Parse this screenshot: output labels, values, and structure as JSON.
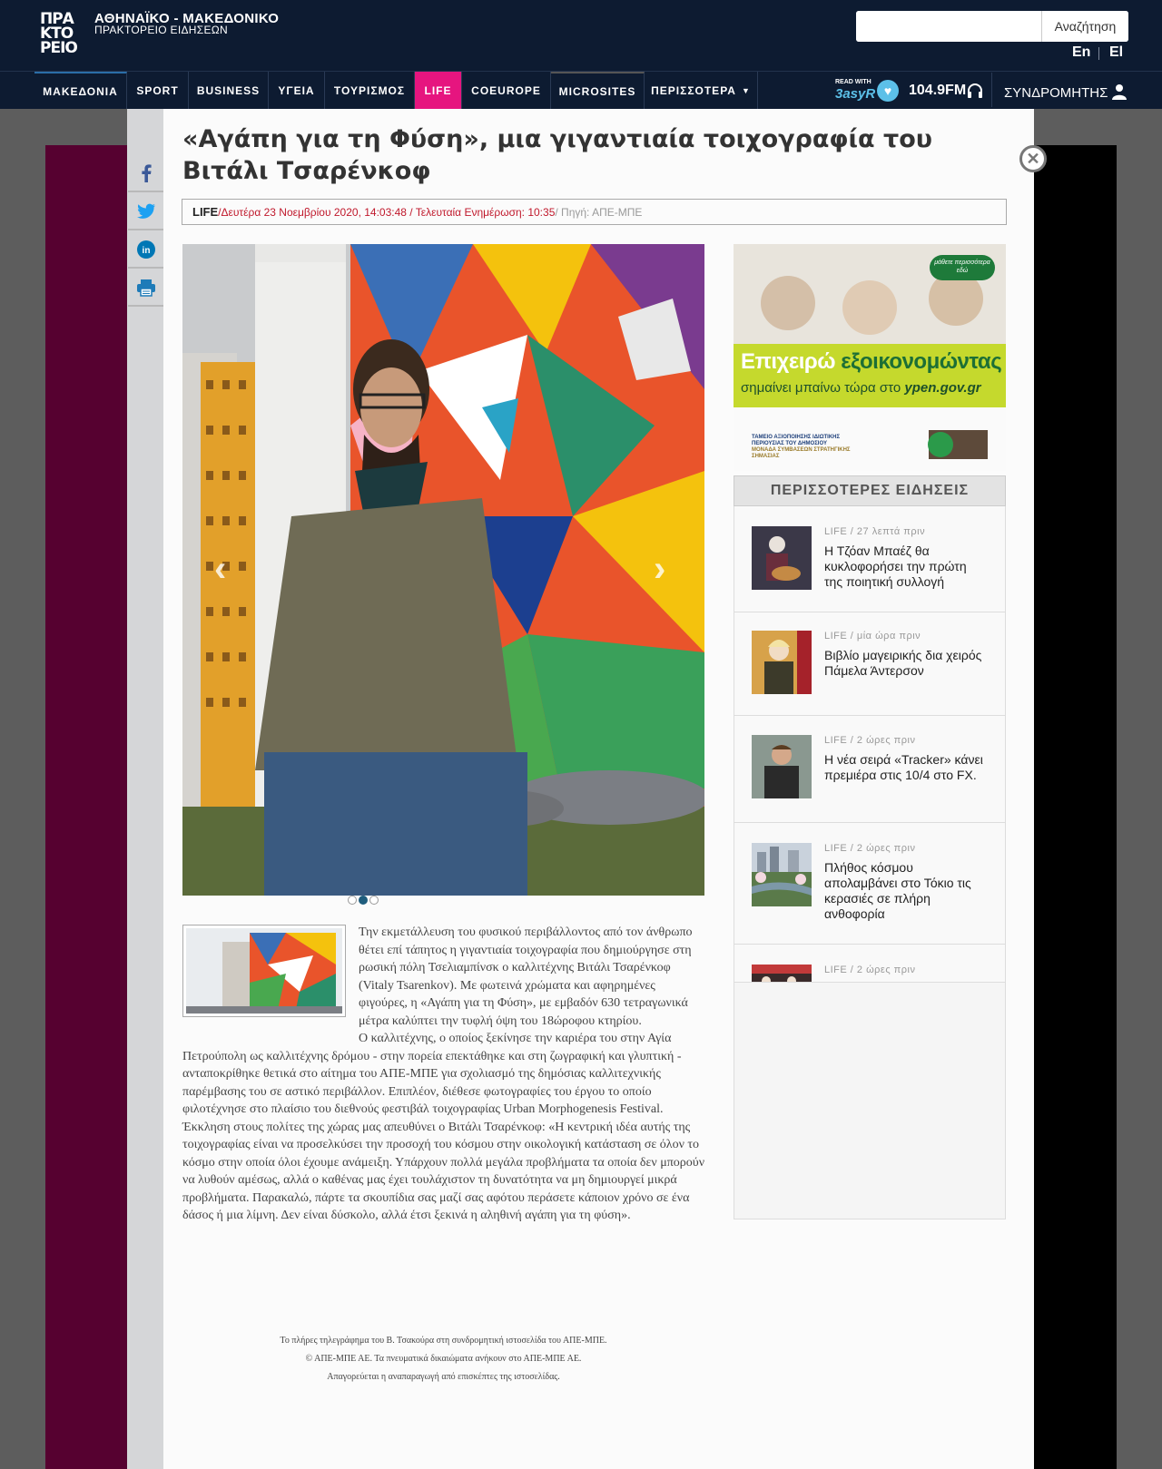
{
  "header": {
    "logo_lines": [
      "ΠΡΑ",
      "ΚΤΟ",
      "ΡΕΙΟ"
    ],
    "brand_title": "ΑΘΗΝΑΪΚΟ - ΜΑΚΕΔΟΝΙΚΟ",
    "brand_subtitle": "ΠΡΑΚΤΟΡΕΙΟ ΕΙΔΗΣΕΩΝ",
    "search": {
      "value": "",
      "button": "Αναζήτηση"
    },
    "lang_en": "En",
    "lang_el": "El"
  },
  "nav": {
    "items": [
      "ΜΑΚΕΔΟΝΙΑ",
      "SPORT",
      "BUSINESS",
      "ΥΓΕΙΑ",
      "ΤΟΥΡΙΣΜΟΣ",
      "LIFE",
      "COEUROPE",
      "MICROSITES",
      "ΠΕΡΙΣΣΟΤΕΡΑ"
    ],
    "easyr_small": "READ WITH",
    "easyr_logo": "3asyR",
    "radio": "104.9FM",
    "subscribers": "ΣΥΝΔΡΟΜΗΤΗΣ"
  },
  "article": {
    "title": "«Αγάπη για τη Φύση», μια γιγαντιαία τοιχογραφία του Βιτάλι Τσαρένκοφ",
    "category": "LIFE",
    "date": " /Δευτέρα 23 Νοεμβρίου 2020, 14:03:48 / Τελευταία Ενημέρωση: 10:35",
    "source": " / Πηγή: ΑΠΕ-ΜΠΕ",
    "paragraphs": [
      "Την εκμετάλλευση του φυσικού περιβάλλοντος από τον άνθρωπο θέτει επί τάπητος η γιγαντιαία τοιχογραφία που δημιούργησε στη ρωσική πόλη Τσελιαμπίνσκ ο καλλιτέχνης Βιτάλι Τσαρένκοφ (Vitaly Tsarenkov). Με φωτεινά χρώματα και αφηρημένες φιγούρες, η «Αγάπη για τη Φύση», με εμβαδόν 630 τετραγωνικά μέτρα καλύπτει την τυφλή όψη του 18ώροφου κτηρίου.",
      "Ο καλλιτέχνης, ο οποίος ξεκίνησε την καριέρα του στην Αγία Πετρούπολη ως καλλιτέχνης δρόμου - στην πορεία επεκτάθηκε και στη ζωγραφική και γλυπτική - ανταποκρίθηκε θετικά στο αίτημα του ΑΠΕ-ΜΠΕ για σχολιασμό της δημόσιας καλλιτεχνικής παρέμβασης του σε αστικό περιβάλλον. Επιπλέον, διέθεσε φωτογραφίες του έργου το οποίο φιλοτέχνησε στο πλαίσιο του διεθνούς φεστιβάλ τοιχογραφίας Urban Morphogenesis Festival.",
      "Έκκληση στους πολίτες της χώρας μας απευθύνει ο Βιτάλι Τσαρένκοφ: «Η κεντρική ιδέα αυτής της τοιχογραφίας είναι να προσελκύσει την προσοχή του κόσμου στην οικολογική κατάσταση σε όλον το κόσμο στην οποία όλοι έχουμε ανάμειξη. Υπάρχουν πολλά μεγάλα προβλήματα τα οποία δεν μπορούν να λυθούν αμέσως, αλλά ο καθένας μας έχει τουλάχιστον τη δυνατότητα να μη δημιουργεί μικρά προβλήματα. Παρακαλώ, πάρτε τα σκουπίδια σας μαζί σας αφότου περάσετε κάποιον χρόνο σε ένα δάσος ή μια λίμνη. Δεν είναι δύσκολο, αλλά έτσι ξεκινά η αληθινή αγάπη για τη φύση»."
    ],
    "footer_lines": [
      "Το πλήρες τηλεγράφημα του Β. Τσακούρα στη συνδρομητική ιστοσελίδα του ΑΠΕ-ΜΠΕ.",
      "© ΑΠΕ-ΜΠΕ ΑΕ. Τα πνευματικά δικαιώματα ανήκουν στο ΑΠΕ-ΜΠΕ ΑΕ.",
      "Απαγορεύεται η αναπαραγωγή από επισκέπτες της ιστοσελίδας."
    ]
  },
  "ad": {
    "badge": "μάθετε περισσότερα εδώ",
    "headline_white": "Επιχειρώ",
    "headline_green": "εξοικονομώντας",
    "line2_a": "σημαίνει μπαίνω τώρα στο",
    "line2_b": "ypen.gov.gr",
    "fund_1": "ΤΑΜΕΙΟ ΑΞΙΟΠΟΙΗΣΗΣ ΙΔΙΩΤΙΚΗΣ",
    "fund_2": "ΠΕΡΙΟΥΣΙΑΣ ΤΟΥ ΔΗΜΟΣΙΟΥ",
    "fund_3": "ΜΟΝΑΔΑ ΣΥΜΒΑΣΕΩΝ ΣΤΡΑΤΗΓΙΚΗΣ",
    "fund_4": "ΣΗΜΑΣΙΑΣ"
  },
  "sidebar": {
    "more_news_title": "ΠΕΡΙΣΣΟΤΕΡΕΣ ΕΙΔΗΣΕΙΣ",
    "items": [
      {
        "meta": "LIFE / 27 λεπτά πριν",
        "title": "Η Τζόαν Μπαέζ θα κυκλοφορήσει την πρώτη της ποιητική συλλογή"
      },
      {
        "meta": "LIFE / μία ώρα πριν",
        "title": "Βιβλίο μαγειρικής δια χειρός Πάμελα Άντερσον"
      },
      {
        "meta": "LIFE / 2 ώρες πριν",
        "title": "Η νέα σειρά «Tracker» κάνει πρεμιέρα στις 10/4 στο FX."
      },
      {
        "meta": "LIFE / 2 ώρες πριν",
        "title": "Πλήθος κόσμου απολαμβάνει στο Τόκιο τις κερασιές σε πλήρη ανθοφορία"
      },
      {
        "meta": "LIFE / 2 ώρες πριν",
        "title": ""
      }
    ]
  },
  "colors": {
    "header_bg": "#0d1b31",
    "life_pink": "#e6157f",
    "date_red": "#c0192c",
    "left_panel": "#560130"
  }
}
